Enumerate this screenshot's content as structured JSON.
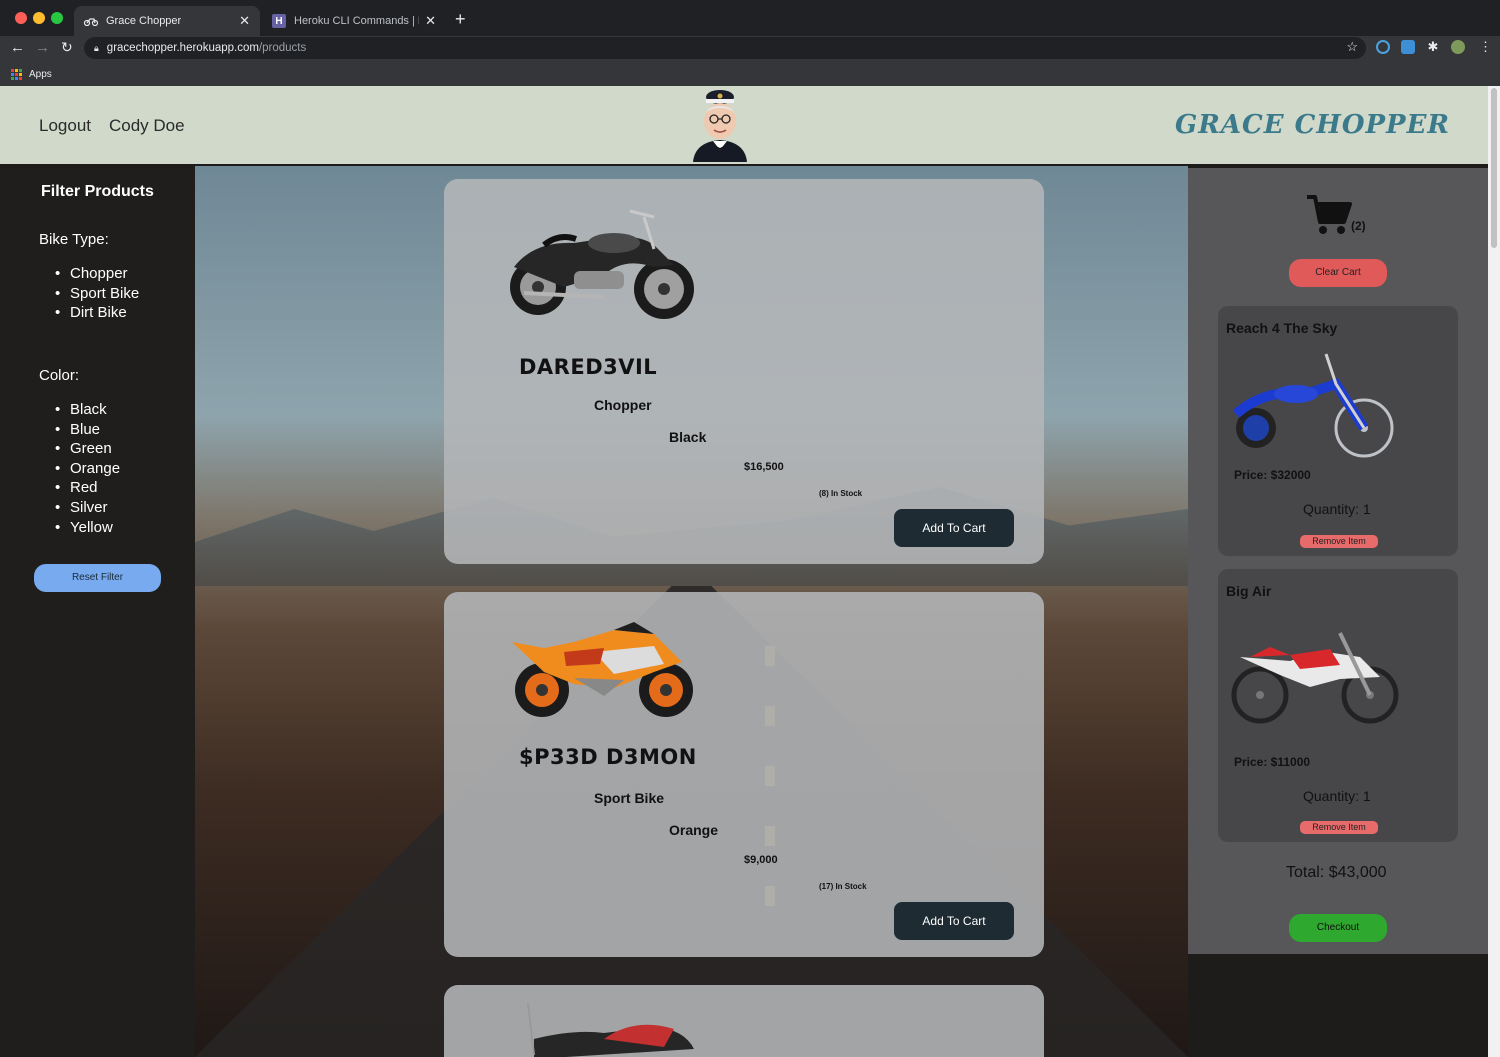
{
  "browser": {
    "tabs": [
      {
        "title": "Grace Chopper",
        "active": true
      },
      {
        "title": "Heroku CLI Commands | Heroku",
        "active": false
      }
    ],
    "url_host": "gracechopper.herokuapp.com",
    "url_path": "/products",
    "bookmarks_label": "Apps"
  },
  "header": {
    "logout": "Logout",
    "user": "Cody Doe",
    "brand": "GRACE CHOPPER"
  },
  "sidebar": {
    "title": "Filter Products",
    "bike_type_label": "Bike Type:",
    "bike_types": [
      "Chopper",
      "Sport Bike",
      "Dirt Bike"
    ],
    "color_label": "Color:",
    "colors": [
      "Black",
      "Blue",
      "Green",
      "Orange",
      "Red",
      "Silver",
      "Yellow"
    ],
    "reset_label": "Reset Filter"
  },
  "products": [
    {
      "name": "DARED3VIL",
      "type": "Chopper",
      "color": "Black",
      "price": "$16,500",
      "stock": "(8) In Stock",
      "button": "Add To Cart"
    },
    {
      "name": "$P33D D3MON",
      "type": "Sport Bike",
      "color": "Orange",
      "price": "$9,000",
      "stock": "(17) In Stock",
      "button": "Add To Cart"
    }
  ],
  "cart": {
    "count": "(2)",
    "clear_label": "Clear Cart",
    "items": [
      {
        "name": "Reach 4 The Sky",
        "price": "Price: $32000",
        "quantity": "Quantity: 1",
        "remove": "Remove Item"
      },
      {
        "name": "Big Air",
        "price": "Price: $11000",
        "quantity": "Quantity: 1",
        "remove": "Remove Item"
      }
    ],
    "total": "Total: $43,000",
    "checkout_label": "Checkout"
  },
  "colors": {
    "header_bg": "#d0d9ca",
    "brand": "#3b7a8b",
    "add_button": "#1e2b33",
    "reset_button": "#77aaee",
    "clear_button": "#e05a5a",
    "checkout_button": "#2ea82e"
  }
}
